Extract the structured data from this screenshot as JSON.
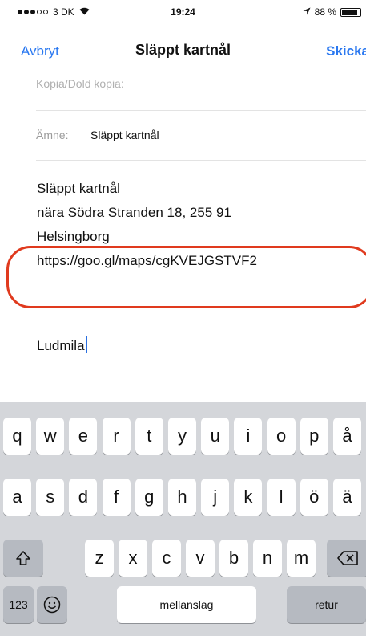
{
  "status_bar": {
    "carrier": "3 DK",
    "time": "19:24",
    "battery": "88 %",
    "battery_level": 0.88
  },
  "nav": {
    "cancel": "Avbryt",
    "title": "Släppt kartnål",
    "send": "Skicka"
  },
  "fields": {
    "cc_label": "Kopia/Dold kopia:",
    "subject_label": "Ämne:",
    "subject_value": "Släppt kartnål"
  },
  "body": {
    "lines": [
      "Släppt kartnål",
      "nära Södra Stranden 18, 255 91",
      "Helsingborg",
      "https://goo.gl/maps/cgKVEJGSTVF2"
    ],
    "signature": "Ludmila"
  },
  "keyboard": {
    "row1": [
      "q",
      "w",
      "e",
      "r",
      "t",
      "y",
      "u",
      "i",
      "o",
      "p",
      "å"
    ],
    "row2": [
      "a",
      "s",
      "d",
      "f",
      "g",
      "h",
      "j",
      "k",
      "l",
      "ö",
      "ä"
    ],
    "row3": [
      "z",
      "x",
      "c",
      "v",
      "b",
      "n",
      "m"
    ],
    "numbers_label": "123",
    "space_label": "mellanslag",
    "return_label": "retur",
    "icons": [
      "shift-icon",
      "backspace-icon",
      "emoji-icon"
    ]
  },
  "colors": {
    "accent": "#2a78f0",
    "highlight": "#e03a1e",
    "keyboard_bg": "#d4d6da"
  }
}
